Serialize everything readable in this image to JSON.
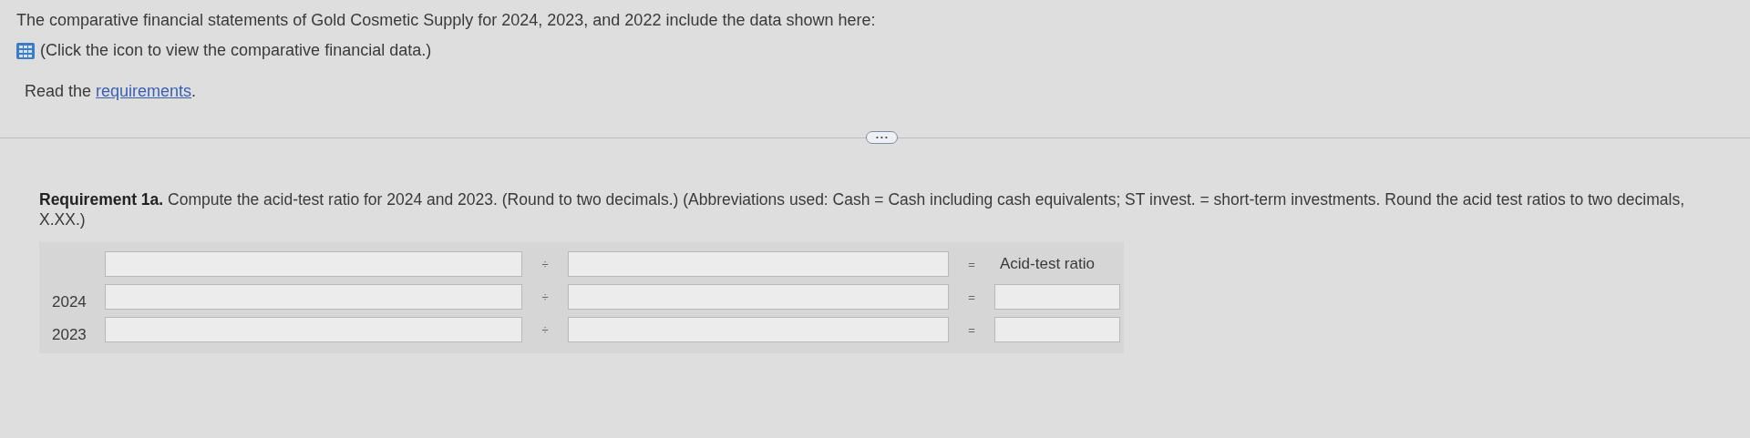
{
  "intro": "The comparative financial statements of Gold Cosmetic Supply for 2024, 2023, and 2022 include the data shown here:",
  "data_link": {
    "text": "(Click the icon to view the comparative financial data.)"
  },
  "read_prompt": {
    "text": "Read the",
    "link": "requirements",
    "after": "."
  },
  "more_button": "• • •",
  "requirement": "**Requirement 1a.** Compute the acid-test ratio for 2024 and 2023. (Round to two decimals.) (Abbreviations used: Cash = Cash including cash equivalents; ST invest. = short-term investments. Round the acid test ratios to two decimals, X.XX.)",
  "table": {
    "header": {
      "divide": "÷",
      "equals": "=",
      "result_heading": "Acid-test ratio"
    },
    "rows": [
      {
        "year": "2024",
        "divide": "÷",
        "equals": "="
      },
      {
        "year": "2023",
        "divide": "÷",
        "equals": "="
      }
    ]
  }
}
